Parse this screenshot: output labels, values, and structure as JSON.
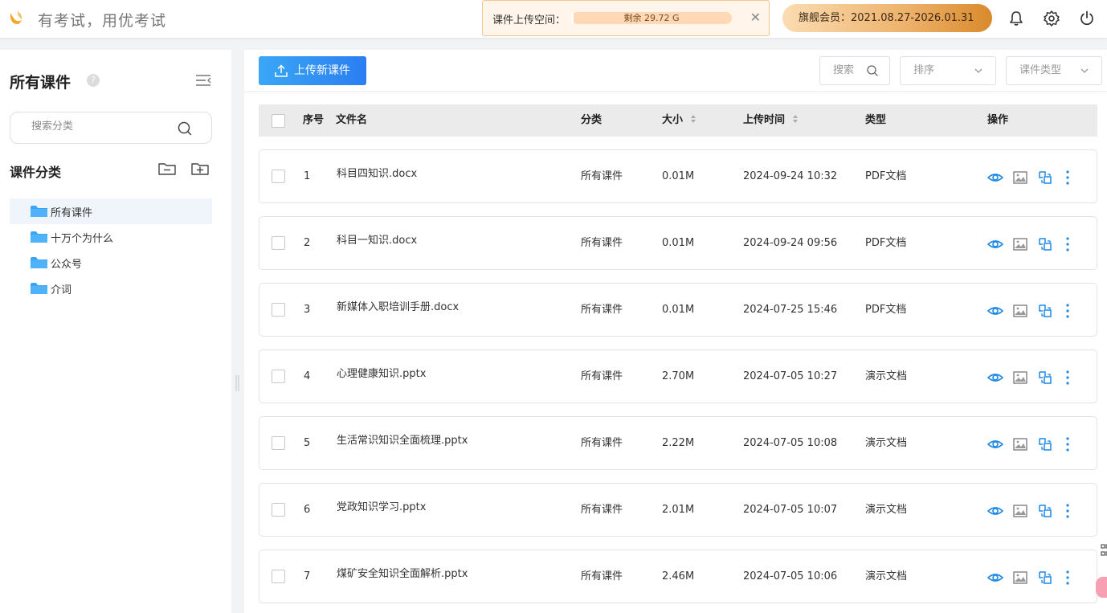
{
  "header": {
    "slogan": "有考试，用优考试",
    "quota_label": "课件上传空间：",
    "quota_remaining": "剩余 29.72 G",
    "quota_used_fraction": 0.01,
    "vip_label": "旗舰会员：2021.08.27-2026.01.31",
    "colors": {
      "brand": "#f5a623",
      "vip_gradient_start": "#fbdcb3",
      "vip_gradient_end": "#d98a2b"
    }
  },
  "sidebar": {
    "title": "所有课件",
    "help_glyph": "?",
    "search_placeholder": "搜索分类",
    "category_title": "课件分类",
    "categories": [
      {
        "label": "所有课件",
        "active": true
      },
      {
        "label": "十万个为什么",
        "active": false
      },
      {
        "label": "公众号",
        "active": false
      },
      {
        "label": "介词",
        "active": false
      }
    ]
  },
  "toolbar": {
    "upload_label": "上传新课件",
    "search_placeholder": "搜索",
    "sort_label": "排序",
    "type_label": "课件类型",
    "accent": "#2b7ef2"
  },
  "table": {
    "columns": {
      "index": "序号",
      "name": "文件名",
      "category": "分类",
      "size": "大小",
      "uploaded": "上传时间",
      "type": "类型",
      "ops": "操作"
    },
    "rows": [
      {
        "index": "1",
        "name": "科目四知识.docx",
        "category": "所有课件",
        "size": "0.01M",
        "uploaded": "2024-09-24 10:32",
        "type": "PDF文档"
      },
      {
        "index": "2",
        "name": "科目一知识.docx",
        "category": "所有课件",
        "size": "0.01M",
        "uploaded": "2024-09-24 09:56",
        "type": "PDF文档"
      },
      {
        "index": "3",
        "name": "新媒体入职培训手册.docx",
        "category": "所有课件",
        "size": "0.01M",
        "uploaded": "2024-07-25 15:46",
        "type": "PDF文档"
      },
      {
        "index": "4",
        "name": "心理健康知识.pptx",
        "category": "所有课件",
        "size": "2.70M",
        "uploaded": "2024-07-05 10:27",
        "type": "演示文档"
      },
      {
        "index": "5",
        "name": "生活常识知识全面梳理.pptx",
        "category": "所有课件",
        "size": "2.22M",
        "uploaded": "2024-07-05 10:08",
        "type": "演示文档"
      },
      {
        "index": "6",
        "name": "党政知识学习.pptx",
        "category": "所有课件",
        "size": "2.01M",
        "uploaded": "2024-07-05 10:07",
        "type": "演示文档"
      },
      {
        "index": "7",
        "name": "煤矿安全知识全面解析.pptx",
        "category": "所有课件",
        "size": "2.46M",
        "uploaded": "2024-07-05 10:06",
        "type": "演示文档"
      }
    ],
    "op_icons": [
      "eye-icon",
      "image-icon",
      "copy-icon",
      "more-icon"
    ],
    "op_color": "#1e88e5"
  }
}
